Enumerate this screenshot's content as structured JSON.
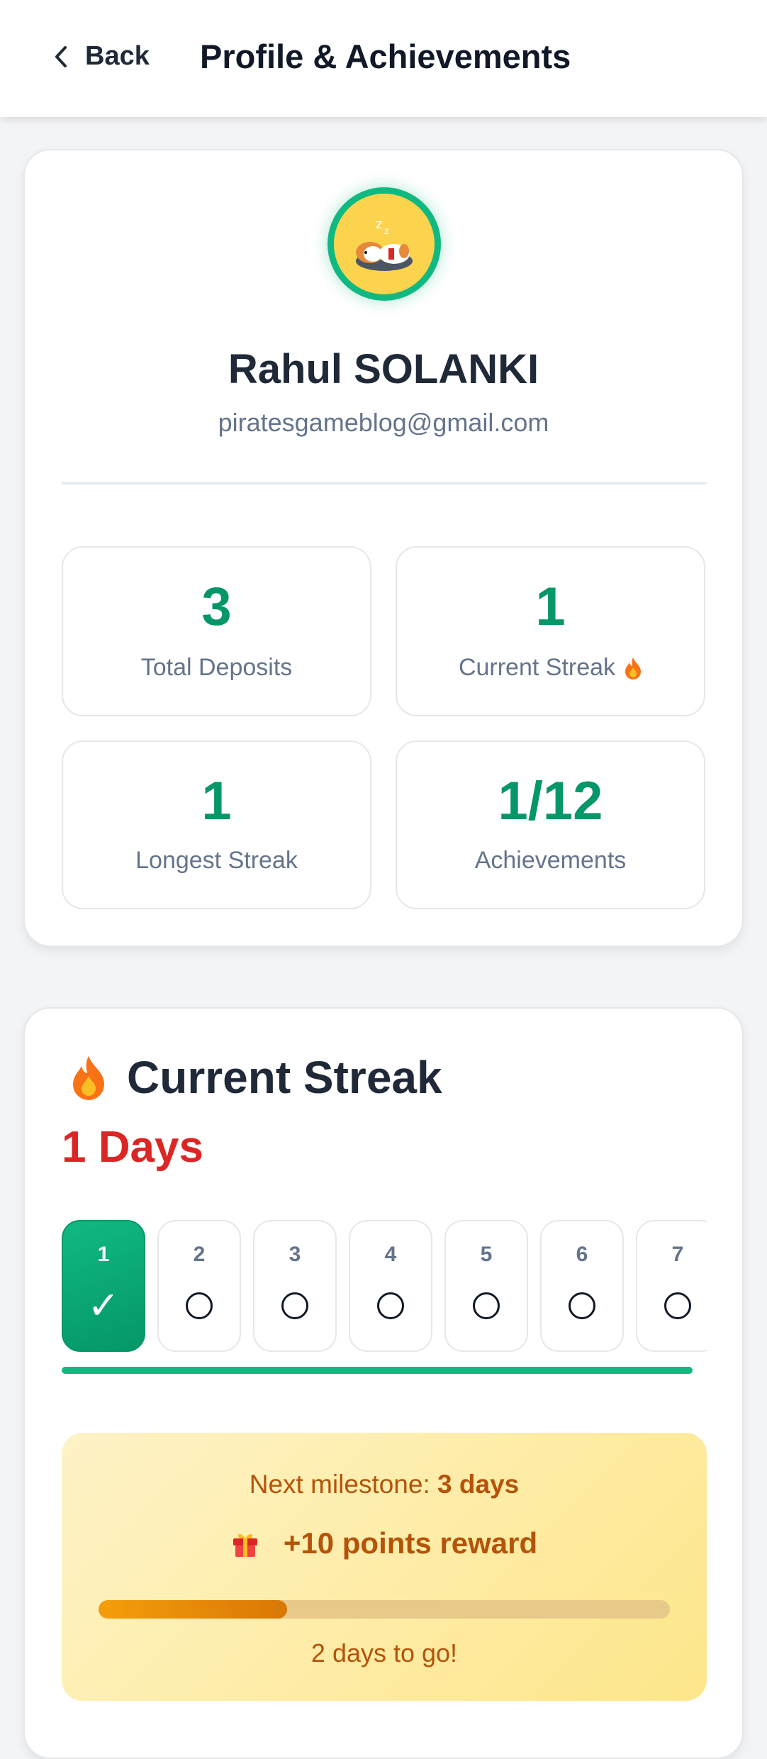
{
  "header": {
    "back_label": "Back",
    "title": "Profile & Achievements"
  },
  "profile": {
    "avatar_icon": "sleeping-dog-avatar",
    "name": "Rahul SOLANKI",
    "email": "piratesgameblog@gmail.com"
  },
  "stats": [
    {
      "value": "3",
      "label": "Total Deposits"
    },
    {
      "value": "1",
      "label": "Current Streak",
      "icon": "fire-icon"
    },
    {
      "value": "1",
      "label": "Longest Streak"
    },
    {
      "value": "1/12",
      "label": "Achievements"
    }
  ],
  "streak": {
    "icon": "fire-icon",
    "title": "Current Streak",
    "days_text": "1 Days",
    "days": [
      {
        "num": "1",
        "done": true,
        "mark": "✓"
      },
      {
        "num": "2",
        "done": false
      },
      {
        "num": "3",
        "done": false
      },
      {
        "num": "4",
        "done": false
      },
      {
        "num": "5",
        "done": false
      },
      {
        "num": "6",
        "done": false
      },
      {
        "num": "7",
        "done": false
      }
    ]
  },
  "milestone": {
    "next_prefix": "Next milestone: ",
    "next_value": "3 days",
    "reward_icon": "gift-icon",
    "reward_text": "+10 points reward",
    "progress": 0.33,
    "togo_text": "2 days to go!"
  },
  "colors": {
    "accent": "#10b981",
    "accent_dark": "#059669",
    "streak_red": "#dc2626",
    "milestone_text": "#b45309"
  }
}
